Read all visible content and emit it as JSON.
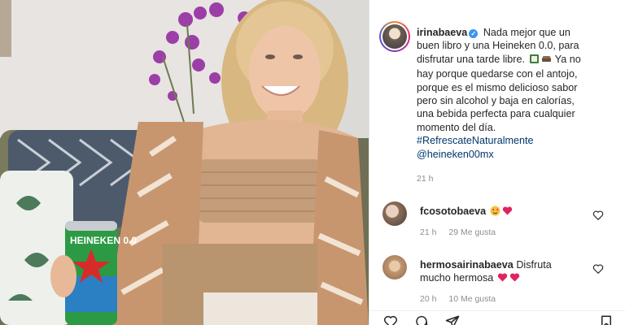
{
  "post": {
    "username": "irinabaeva",
    "caption_lines": [
      "Nada mejor que un",
      "buen libro y una Heineken 0.0, para",
      "disfrutar una tarde libre.",
      "Ya no",
      "hay porque quedarse con el antojo,",
      "porque es el mismo delicioso sabor",
      "pero sin alcohol y baja en calorías,",
      "una bebida perfecta para cualquier",
      "momento del día."
    ],
    "hashtag": "#RefrescateNaturalmente",
    "mention": "@heineken00mx",
    "time": "21 h",
    "photo_can_text": "HEINEKEN 0.0"
  },
  "comments": [
    {
      "username": "fcosotobaeva",
      "text": "",
      "time": "21 h",
      "likes": "29 Me gusta",
      "reply": ""
    },
    {
      "username": "hermosairinabaeva",
      "text": "Disfruta",
      "text2": "mucho hermosa",
      "time": "20 h",
      "likes": "10 Me gusta",
      "reply": ""
    }
  ],
  "colors": {
    "link": "#00376b",
    "muted": "#8e8e8e",
    "heart": "#ed4956",
    "verified": "#3897f0",
    "divider": "#e3e3e3"
  },
  "icons": {
    "heart": "heart-icon",
    "comment": "comment-icon",
    "share": "paper-plane-icon",
    "save": "bookmark-icon"
  }
}
